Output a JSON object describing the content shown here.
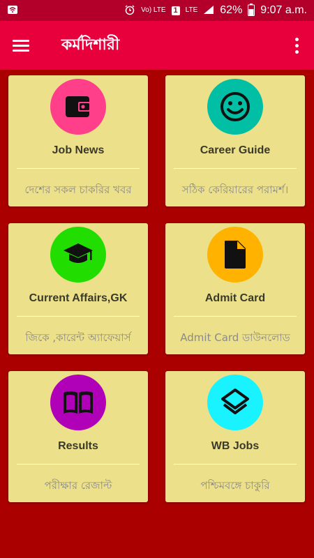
{
  "status_bar": {
    "volte_label": "Vo) LTE",
    "sim_label": "1",
    "lte_label": "LTE",
    "battery_percent": "62%",
    "time": "9:07 a.m."
  },
  "app_bar": {
    "title": "কর্মদিশারী"
  },
  "cards": [
    {
      "title": "Job News",
      "subtitle": "দেশের সকল চাকরির খবর",
      "icon": "wallet-icon",
      "color": "#ff3f8a"
    },
    {
      "title": "Career Guide",
      "subtitle": "সঠিক কেরিয়ারের পরামর্শ।",
      "icon": "smiley-icon",
      "color": "#00bfa5"
    },
    {
      "title": "Current Affairs,GK",
      "subtitle": "জিকে ,কারেন্ট অ্যাফেয়ার্স",
      "icon": "graduation-cap-icon",
      "color": "#22dd00"
    },
    {
      "title": "Admit Card",
      "subtitle": "Admit Card ডাউনলোড",
      "icon": "document-icon",
      "color": "#ffb300"
    },
    {
      "title": "Results",
      "subtitle": "পরীক্ষার রেজাল্ট",
      "icon": "book-icon",
      "color": "#b000b8"
    },
    {
      "title": "WB Jobs",
      "subtitle": "পশ্চিমবঙ্গে চাকুরি",
      "icon": "layers-icon",
      "color": "#19f3ff"
    }
  ]
}
